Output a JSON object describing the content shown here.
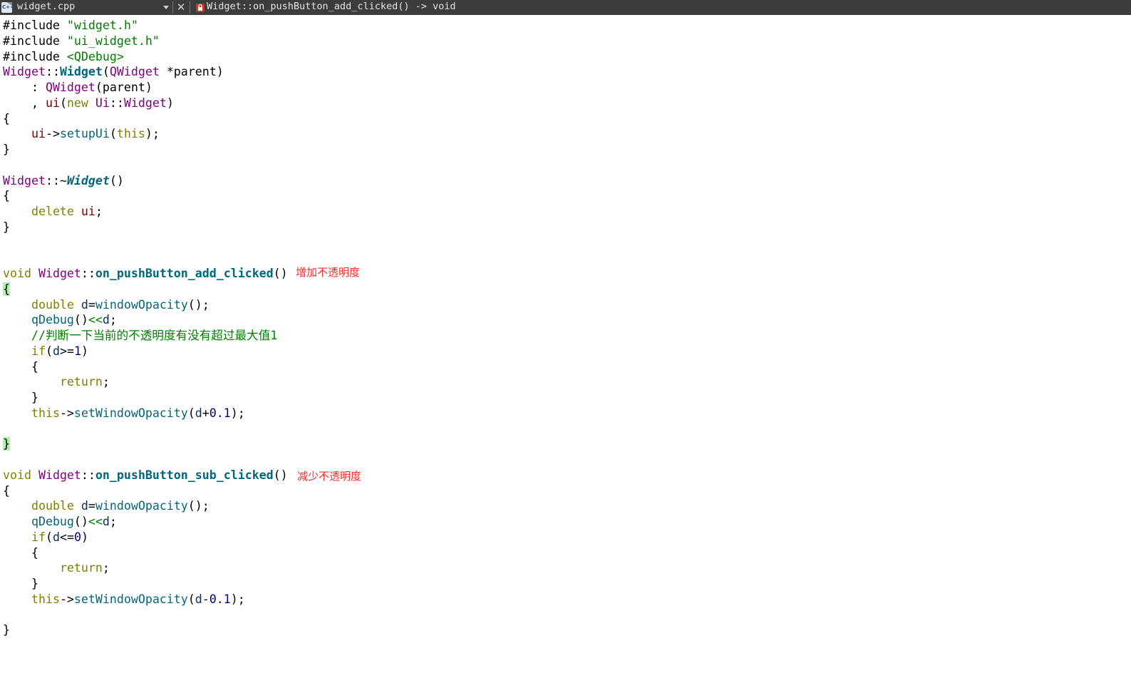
{
  "toolbar": {
    "file_name": "widget.cpp",
    "symbol_signature": "Widget::on_pushButton_add_clicked() -> void"
  },
  "code_lines": [
    [
      [
        "#include ",
        "op"
      ],
      [
        "\"widget.h\"",
        "str"
      ]
    ],
    [
      [
        "#include ",
        "op"
      ],
      [
        "\"ui_widget.h\"",
        "str"
      ]
    ],
    [
      [
        "#include ",
        "op"
      ],
      [
        "<QDebug>",
        "str"
      ]
    ],
    [
      [
        "Widget",
        "type"
      ],
      [
        "::",
        "op"
      ],
      [
        "Widget",
        "fn"
      ],
      [
        "(",
        "op"
      ],
      [
        "QWidget",
        "type"
      ],
      [
        " *parent)",
        "op"
      ]
    ],
    [
      [
        "    : ",
        "op"
      ],
      [
        "QWidget",
        "type"
      ],
      [
        "(parent)",
        "op"
      ]
    ],
    [
      [
        "    , ",
        "op"
      ],
      [
        "ui",
        "mem"
      ],
      [
        "(",
        "op"
      ],
      [
        "new",
        "kw"
      ],
      [
        " ",
        "op"
      ],
      [
        "Ui",
        "type"
      ],
      [
        "::",
        "op"
      ],
      [
        "Widget",
        "type"
      ],
      [
        ")",
        "op"
      ]
    ],
    [
      [
        "{",
        "op"
      ]
    ],
    [
      [
        "    ",
        "op"
      ],
      [
        "ui",
        "mem"
      ],
      [
        "->",
        "op"
      ],
      [
        "setupUi",
        "call"
      ],
      [
        "(",
        "op"
      ],
      [
        "this",
        "kw"
      ],
      [
        ");",
        "op"
      ]
    ],
    [
      [
        "}",
        "op"
      ]
    ],
    [],
    [
      [
        "Widget",
        "type"
      ],
      [
        "::~",
        "op"
      ],
      [
        "Widget",
        "fni"
      ],
      [
        "()",
        "op"
      ]
    ],
    [
      [
        "{",
        "op"
      ]
    ],
    [
      [
        "    ",
        "op"
      ],
      [
        "delete",
        "kw"
      ],
      [
        " ",
        "op"
      ],
      [
        "ui",
        "mem"
      ],
      [
        ";",
        "op"
      ]
    ],
    [
      [
        "}",
        "op"
      ]
    ],
    [],
    [],
    [
      [
        "void",
        "kw"
      ],
      [
        " ",
        "op"
      ],
      [
        "Widget",
        "type"
      ],
      [
        "::",
        "op"
      ],
      [
        "on_pushButton_add_clicked",
        "fn"
      ],
      [
        "()",
        "op"
      ]
    ],
    [
      [
        "{",
        "hl"
      ]
    ],
    [
      [
        "    ",
        "op"
      ],
      [
        "double",
        "kw"
      ],
      [
        " ",
        "op"
      ],
      [
        "d",
        "loc"
      ],
      [
        "=",
        "op"
      ],
      [
        "windowOpacity",
        "call"
      ],
      [
        "();",
        "op"
      ]
    ],
    [
      [
        "    ",
        "op"
      ],
      [
        "qDebug",
        "call"
      ],
      [
        "()",
        "op"
      ],
      [
        "<<",
        "str"
      ],
      [
        "d",
        "loc"
      ],
      [
        ";",
        "op"
      ]
    ],
    [
      [
        "    //判断一下当前的不透明度有没有超过最大值1",
        "com"
      ]
    ],
    [
      [
        "    ",
        "op"
      ],
      [
        "if",
        "kw"
      ],
      [
        "(",
        "op"
      ],
      [
        "d",
        "loc"
      ],
      [
        ">=",
        "op"
      ],
      [
        "1",
        "num"
      ],
      [
        ")",
        "op"
      ]
    ],
    [
      [
        "    {",
        "op"
      ]
    ],
    [
      [
        "        ",
        "op"
      ],
      [
        "return",
        "kw"
      ],
      [
        ";",
        "op"
      ]
    ],
    [
      [
        "    }",
        "op"
      ]
    ],
    [
      [
        "    ",
        "op"
      ],
      [
        "this",
        "kw"
      ],
      [
        "->",
        "op"
      ],
      [
        "setWindowOpacity",
        "call"
      ],
      [
        "(",
        "op"
      ],
      [
        "d",
        "loc"
      ],
      [
        "+",
        "op"
      ],
      [
        "0.1",
        "num"
      ],
      [
        ");",
        "op"
      ]
    ],
    [],
    [
      [
        "}",
        "hl"
      ]
    ],
    [],
    [
      [
        "void",
        "kw"
      ],
      [
        " ",
        "op"
      ],
      [
        "Widget",
        "type"
      ],
      [
        "::",
        "op"
      ],
      [
        "on_pushButton_sub_clicked",
        "fn"
      ],
      [
        "()",
        "op"
      ]
    ],
    [
      [
        "{",
        "op"
      ]
    ],
    [
      [
        "    ",
        "op"
      ],
      [
        "double",
        "kw"
      ],
      [
        " ",
        "op"
      ],
      [
        "d",
        "loc"
      ],
      [
        "=",
        "op"
      ],
      [
        "windowOpacity",
        "call"
      ],
      [
        "();",
        "op"
      ]
    ],
    [
      [
        "    ",
        "op"
      ],
      [
        "qDebug",
        "call"
      ],
      [
        "()",
        "op"
      ],
      [
        "<<",
        "str"
      ],
      [
        "d",
        "loc"
      ],
      [
        ";",
        "op"
      ]
    ],
    [
      [
        "    ",
        "op"
      ],
      [
        "if",
        "kw"
      ],
      [
        "(",
        "op"
      ],
      [
        "d",
        "loc"
      ],
      [
        "<=",
        "op"
      ],
      [
        "0",
        "num"
      ],
      [
        ")",
        "op"
      ]
    ],
    [
      [
        "    {",
        "op"
      ]
    ],
    [
      [
        "        ",
        "op"
      ],
      [
        "return",
        "kw"
      ],
      [
        ";",
        "op"
      ]
    ],
    [
      [
        "    }",
        "op"
      ]
    ],
    [
      [
        "    ",
        "op"
      ],
      [
        "this",
        "kw"
      ],
      [
        "->",
        "op"
      ],
      [
        "setWindowOpacity",
        "call"
      ],
      [
        "(",
        "op"
      ],
      [
        "d",
        "loc"
      ],
      [
        "-",
        "op"
      ],
      [
        "0.1",
        "num"
      ],
      [
        ");",
        "op"
      ]
    ],
    [],
    [
      [
        "}",
        "op"
      ]
    ]
  ],
  "annotations": {
    "add": "增加不透明度",
    "sub": "减少不透明度"
  },
  "colors": {
    "topbar_bg": "#3c3c3c",
    "keyword": "#808000",
    "type": "#800080",
    "function": "#00677c",
    "string": "#008000",
    "annotation": "#ff2a2a",
    "brace_highlight": "#b4eeb4"
  }
}
